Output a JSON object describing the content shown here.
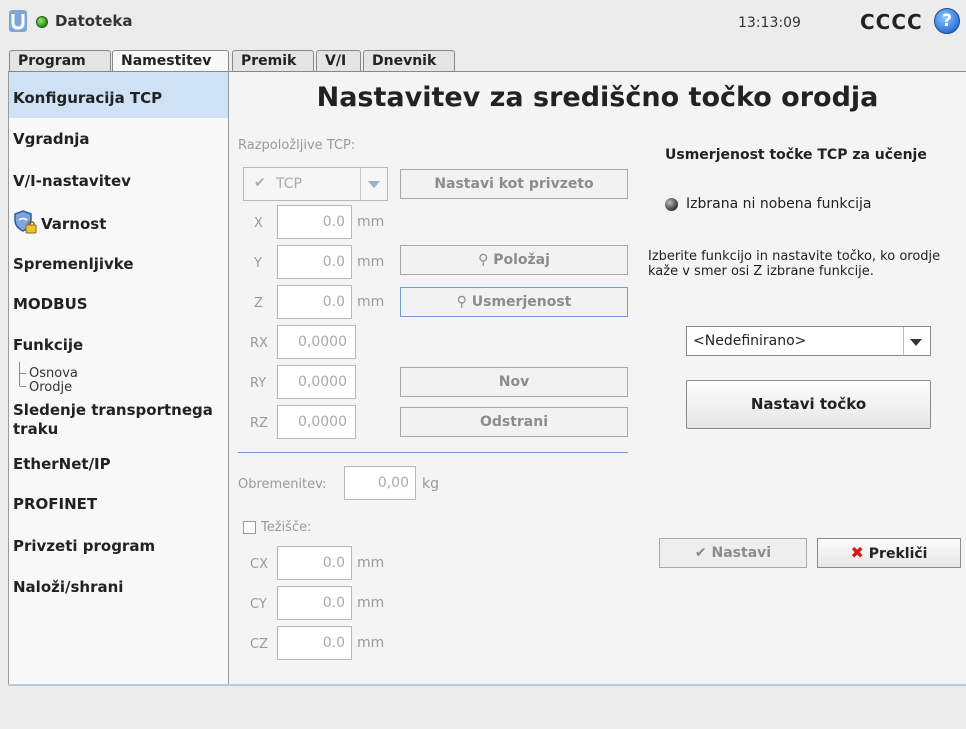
{
  "topbar": {
    "menu_label": "Datoteka",
    "time": "13:13:09",
    "robot_name": "CCCC",
    "help_glyph": "?"
  },
  "tabs": [
    {
      "label": "Program",
      "active": false
    },
    {
      "label": "Namestitev",
      "active": true
    },
    {
      "label": "Premik",
      "active": false
    },
    {
      "label": "V/I",
      "active": false
    },
    {
      "label": "Dnevnik",
      "active": false
    }
  ],
  "sidebar": {
    "items": [
      {
        "label": "Konfiguracija TCP",
        "selected": true
      },
      {
        "label": "Vgradnja"
      },
      {
        "label": "V/I-nastavitev"
      },
      {
        "label": "Varnost",
        "icon": "shield-lock-icon"
      },
      {
        "label": "Spremenljivke"
      },
      {
        "label": "MODBUS"
      },
      {
        "label": "Funkcije"
      },
      {
        "label": "Sledenje transportnega traku"
      },
      {
        "label": "EtherNet/IP"
      },
      {
        "label": "PROFINET"
      },
      {
        "label": "Privzeti program"
      },
      {
        "label": "Naloži/shrani"
      }
    ],
    "sub_items": [
      "Osnova",
      "Orodje"
    ]
  },
  "main": {
    "title": "Nastavitev za središčno točko orodja",
    "available_label": "Razpoložljive TCP:",
    "tcp_select_value": "TCP",
    "set_default_button": "Nastavi kot privzeto",
    "coords": [
      {
        "axis": "X",
        "value": "0.0",
        "unit": "mm"
      },
      {
        "axis": "Y",
        "value": "0.0",
        "unit": "mm"
      },
      {
        "axis": "Z",
        "value": "0.0",
        "unit": "mm"
      },
      {
        "axis": "RX",
        "value": "0,0000"
      },
      {
        "axis": "RY",
        "value": "0,0000"
      },
      {
        "axis": "RZ",
        "value": "0,0000"
      }
    ],
    "position_button": "Položaj",
    "orientation_button": "Usmerjenost",
    "new_button": "Nov",
    "remove_button": "Odstrani",
    "payload_label": "Obremenitev:",
    "payload_value": "0,00",
    "payload_unit": "kg",
    "cog_label": "Težišče:",
    "cog": [
      {
        "axis": "CX",
        "value": "0.0",
        "unit": "mm"
      },
      {
        "axis": "CY",
        "value": "0.0",
        "unit": "mm"
      },
      {
        "axis": "CZ",
        "value": "0.0",
        "unit": "mm"
      }
    ]
  },
  "teach": {
    "heading": "Usmerjenost točke TCP za učenje",
    "status": "Izbrana ni nobena funkcija",
    "instructions": "Izberite funkcijo in nastavite točko, ko orodje kaže v smer osi Z izbrane funkcije.",
    "dropdown_value": "<Nedefinirano>",
    "set_point_button": "Nastavi točko",
    "apply_button": "Nastavi",
    "cancel_button": "Prekliči"
  },
  "colors": {
    "selected_bg": "#cfe1f5",
    "status_green": "#2e8b1e",
    "cancel_red": "#d11a1a",
    "help_blue": "#2a6fd1"
  }
}
